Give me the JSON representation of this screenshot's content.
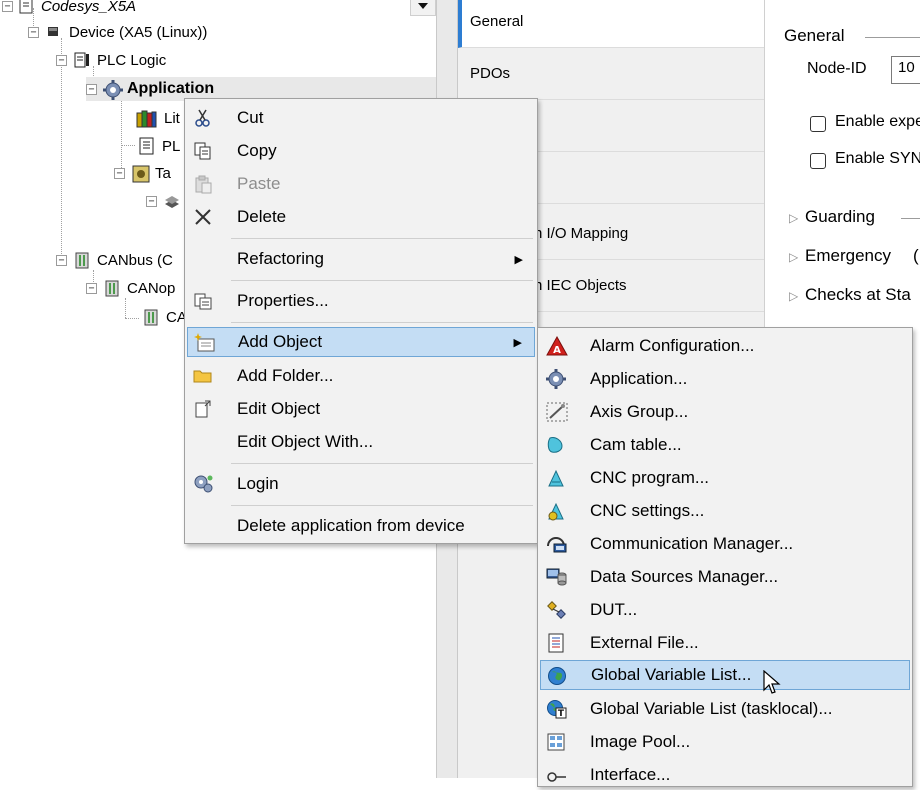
{
  "tree": {
    "items": [
      {
        "label": "Codesys_X5A",
        "italic": true
      },
      {
        "label": "Device (XA5 (Linux))"
      },
      {
        "label": "PLC Logic"
      },
      {
        "label": "Application",
        "bold": true
      },
      {
        "label": "Lit"
      },
      {
        "label": "PL"
      },
      {
        "label": "Ta"
      },
      {
        "label": ""
      },
      {
        "label": "CANbus (C"
      },
      {
        "label": "CANop"
      },
      {
        "label": "CA"
      }
    ]
  },
  "tabs": [
    {
      "label": "General",
      "active": true
    },
    {
      "label": "PDOs"
    },
    {
      "label": ""
    },
    {
      "label": ""
    },
    {
      "label": "n I/O Mapping"
    },
    {
      "label": "n IEC Objects"
    }
  ],
  "panel": {
    "general_title": "General",
    "node_id_label": "Node-ID",
    "node_id_value": "10",
    "check1_label": "Enable expe",
    "check2_label": "Enable SYN",
    "guarding": "Guarding",
    "emergency": "Emergency",
    "emergency_paren": "(",
    "checks": "Checks at Sta"
  },
  "context_menu": {
    "items": [
      {
        "label": "Cut",
        "icon": "scissors-icon"
      },
      {
        "label": "Copy",
        "icon": "copy-icon"
      },
      {
        "label": "Paste",
        "icon": "paste-icon",
        "disabled": true
      },
      {
        "label": "Delete",
        "icon": "delete-x-icon"
      },
      {
        "label": "Refactoring",
        "submenu": true
      },
      {
        "label": "Properties...",
        "icon": "properties-icon"
      },
      {
        "label": "Add Object",
        "icon": "add-object-icon",
        "submenu": true,
        "highlighted": true
      },
      {
        "label": "Add Folder...",
        "icon": "folder-icon"
      },
      {
        "label": "Edit Object",
        "icon": "edit-object-icon"
      },
      {
        "label": "Edit Object With..."
      },
      {
        "label": "Login",
        "icon": "login-gears-icon"
      },
      {
        "label": "Delete application from device"
      }
    ]
  },
  "add_object_menu": {
    "items": [
      {
        "label": "Alarm Configuration...",
        "icon": "alarm-icon"
      },
      {
        "label": "Application...",
        "icon": "gear-icon"
      },
      {
        "label": "Axis Group...",
        "icon": "axis-group-icon"
      },
      {
        "label": "Cam table...",
        "icon": "cam-table-icon"
      },
      {
        "label": "CNC program...",
        "icon": "cnc-program-icon"
      },
      {
        "label": "CNC settings...",
        "icon": "cnc-settings-icon"
      },
      {
        "label": "Communication Manager...",
        "icon": "communication-icon"
      },
      {
        "label": "Data Sources Manager...",
        "icon": "data-sources-icon"
      },
      {
        "label": "DUT...",
        "icon": "dut-icon"
      },
      {
        "label": "External File...",
        "icon": "external-file-icon"
      },
      {
        "label": "Global Variable List...",
        "icon": "globe-icon",
        "highlighted": true
      },
      {
        "label": "Global Variable List (tasklocal)...",
        "icon": "globe-tasklocal-icon"
      },
      {
        "label": "Image Pool...",
        "icon": "image-pool-icon"
      },
      {
        "label": "Interface...",
        "icon": "interface-icon"
      }
    ]
  },
  "colors": {
    "highlight": "#c4ddf4",
    "highlight_border": "#6fa6d6",
    "active_tab_accent": "#2d7dd2"
  }
}
